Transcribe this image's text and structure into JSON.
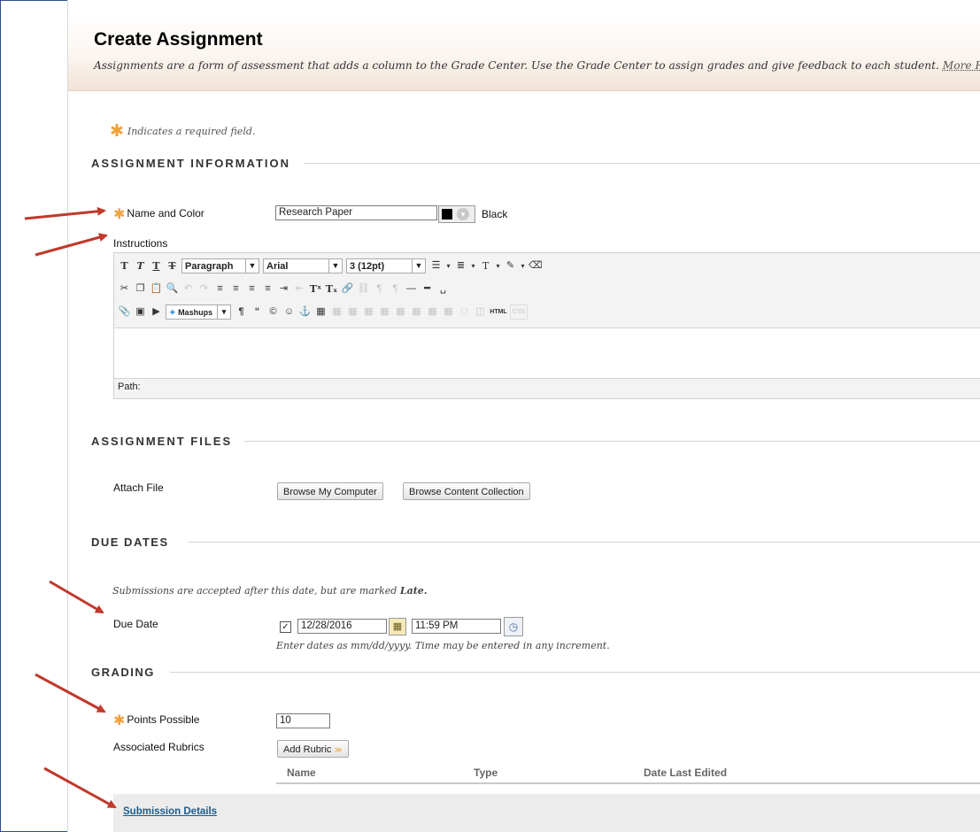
{
  "page": {
    "title": "Create Assignment",
    "subtitle": "Assignments are a form of assessment that adds a column to the Grade Center. Use the Grade Center to assign grades and give feedback to each student.",
    "more_help": "More Help",
    "required_note": "Indicates a required field."
  },
  "assignment_information": {
    "heading": "ASSIGNMENT INFORMATION",
    "name_label": "Name and Color",
    "name_value": "Research Paper",
    "color_name": "Black",
    "color_value": "#000000",
    "instructions_label": "Instructions",
    "editor": {
      "format_select": "Paragraph",
      "font_select": "Arial",
      "size_select": "3 (12pt)",
      "mashups_label": "Mashups",
      "html_label": "HTML",
      "css_label": "CSS",
      "path_label": "Path:"
    }
  },
  "assignment_files": {
    "heading": "ASSIGNMENT FILES",
    "attach_label": "Attach File",
    "browse_computer": "Browse My Computer",
    "browse_collection": "Browse Content Collection"
  },
  "due_dates": {
    "heading": "DUE DATES",
    "note_prefix": "Submissions are accepted after this date, but are marked",
    "note_late": "Late.",
    "due_label": "Due Date",
    "due_checked": true,
    "date_value": "12/28/2016",
    "time_value": "11:59 PM",
    "hint": "Enter dates as mm/dd/yyyy. Time may be entered in any increment."
  },
  "grading": {
    "heading": "GRADING",
    "points_label": "Points Possible",
    "points_value": "10",
    "rubrics_label": "Associated Rubrics",
    "add_rubric": "Add Rubric",
    "columns": [
      "Name",
      "Type",
      "Date Last Edited"
    ],
    "submission_details": "Submission Details"
  },
  "colors": {
    "accent_star": "#f2a13a",
    "annotation_arrow": "#c0392b",
    "link": "#1c5c8b"
  }
}
